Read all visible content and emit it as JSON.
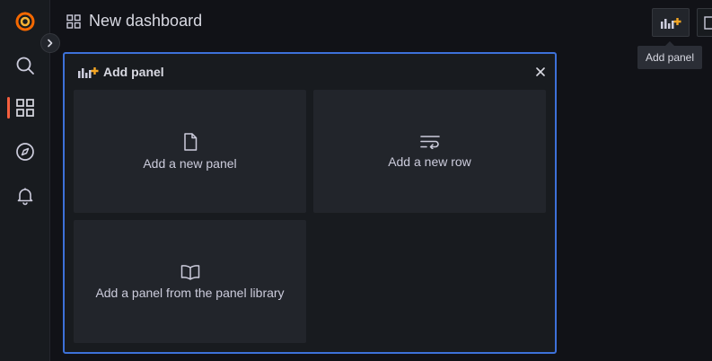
{
  "sidebar": {
    "items": [
      {
        "icon": "grafana-logo-icon"
      },
      {
        "icon": "search-icon"
      },
      {
        "icon": "dashboards-icon",
        "active": true
      },
      {
        "icon": "explore-compass-icon"
      },
      {
        "icon": "alerting-bell-icon"
      }
    ],
    "expand_icon": "chevron-right-icon"
  },
  "header": {
    "title": "New dashboard",
    "icon": "dashboards-icon"
  },
  "toolbar": {
    "add_panel_icon": "add-panel-icon",
    "tooltip": "Add panel"
  },
  "add_panel_dialog": {
    "title": "Add panel",
    "close_icon": "close-icon",
    "options": [
      {
        "label": "Add a new panel",
        "icon": "file-icon"
      },
      {
        "label": "Add a new row",
        "icon": "wrap-text-icon"
      },
      {
        "label": "Add a panel from the panel library",
        "icon": "book-open-icon"
      }
    ]
  },
  "colors": {
    "background": "#111217",
    "sidebar": "#181b1f",
    "card": "#22252b",
    "accent_border": "#3d71d9",
    "brand_orange": "#f55f3e",
    "plus_orange": "#f5a623"
  }
}
